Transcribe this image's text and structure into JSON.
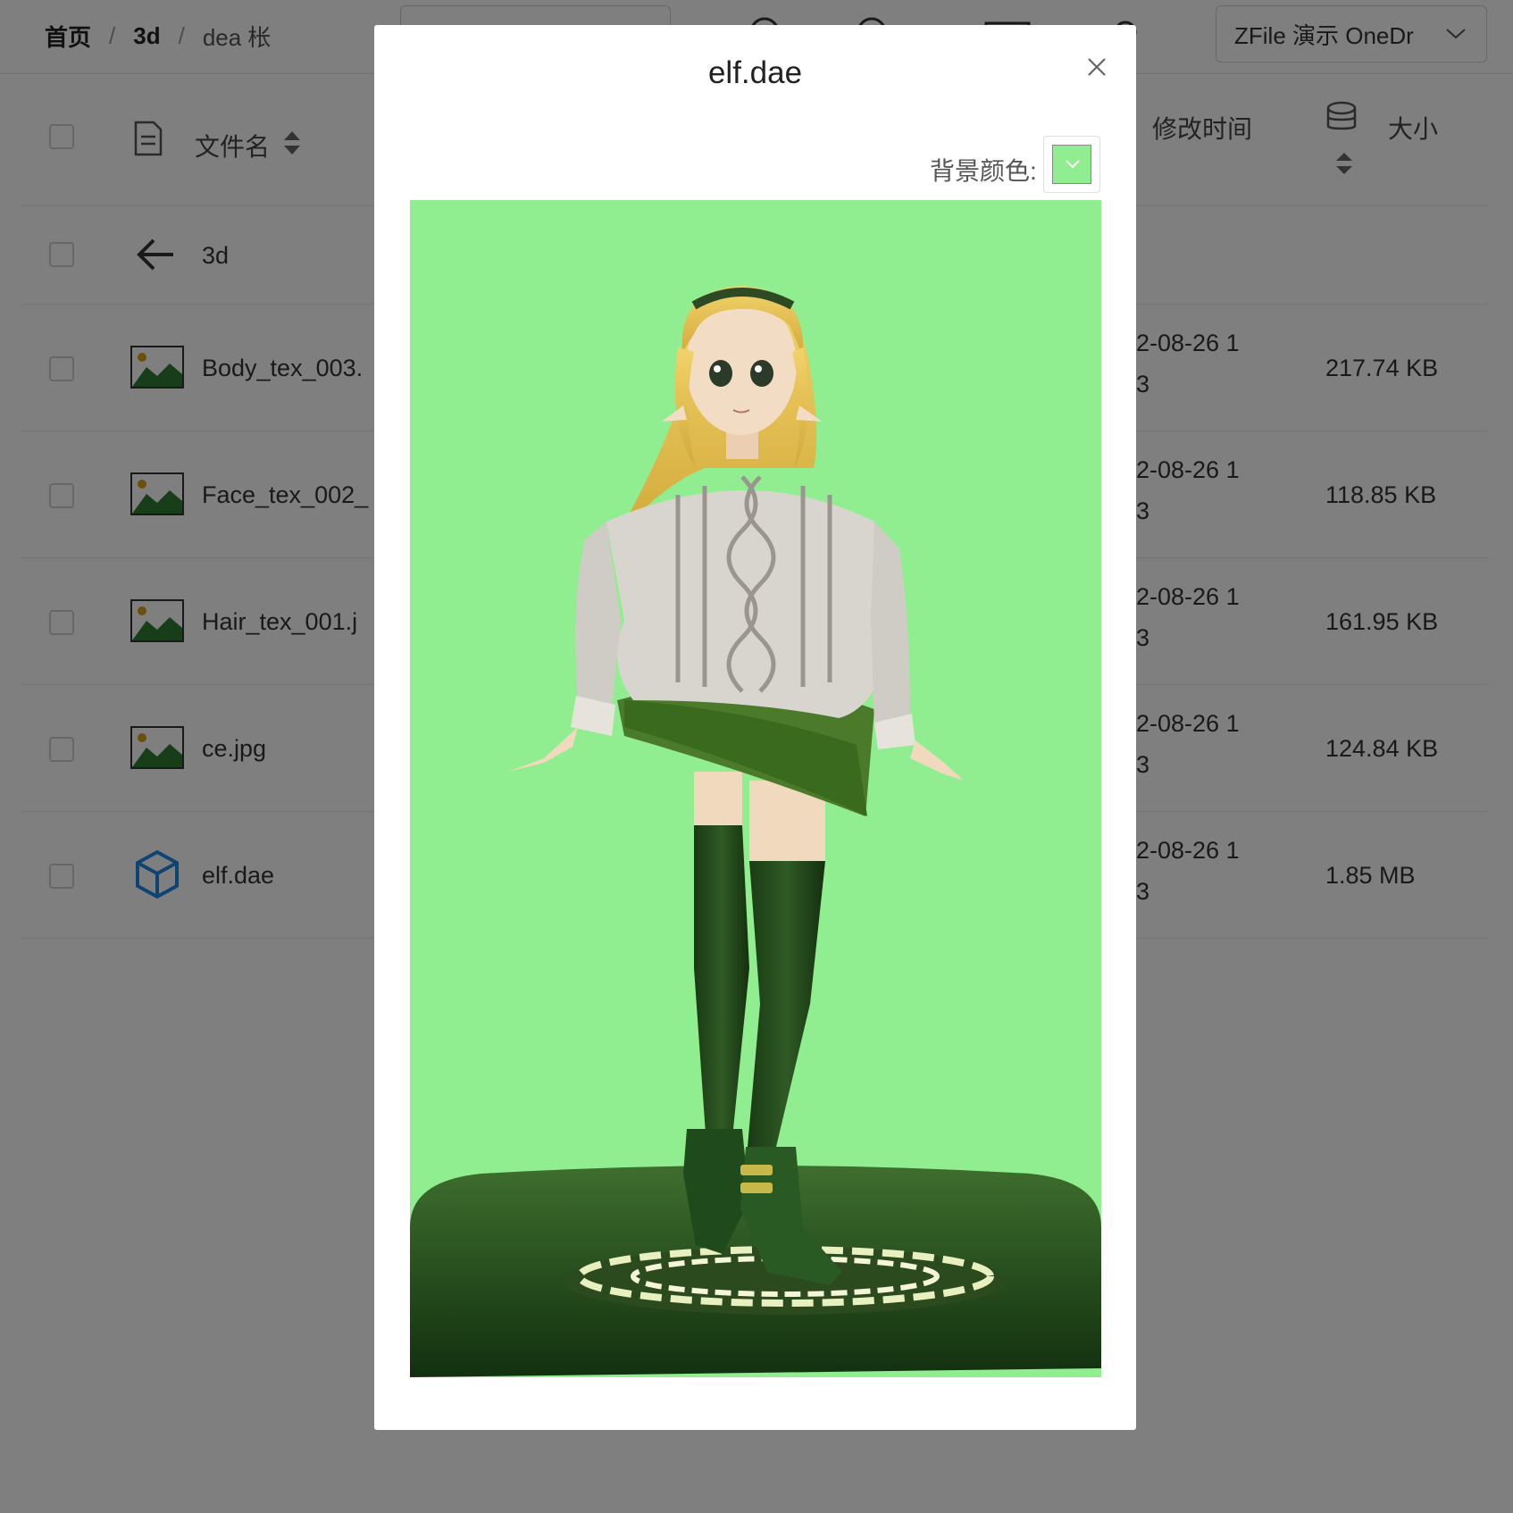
{
  "breadcrumb": {
    "home": "首页",
    "sep": "/",
    "folder": "3d",
    "current": "dea 枨"
  },
  "storage": {
    "selected": "ZFile 演示 OneDr"
  },
  "table": {
    "header": {
      "name": "文件名",
      "time": "修改时间",
      "size": "大小"
    },
    "back_label": "3d",
    "rows": [
      {
        "name": "Body_tex_003.",
        "time": "2-08-26 1",
        "time2": "3",
        "size": "217.74 KB",
        "icon": "image-file-icon"
      },
      {
        "name": "Face_tex_002_",
        "time": "2-08-26 1",
        "time2": "3",
        "size": "118.85 KB",
        "icon": "image-file-icon"
      },
      {
        "name": "Hair_tex_001.j",
        "time": "2-08-26 1",
        "time2": "3",
        "size": "161.95 KB",
        "icon": "image-file-icon"
      },
      {
        "name": "ce.jpg",
        "time": "2-08-26 1",
        "time2": "3",
        "size": "124.84 KB",
        "icon": "image-file-icon"
      },
      {
        "name": "elf.dae",
        "time": "2-08-26 1",
        "time2": "3",
        "size": "1.85 MB",
        "icon": "3d-model-cube-icon"
      }
    ]
  },
  "modal": {
    "title": "elf.dae",
    "bg_color_label": "背景颜色:",
    "bg_color": "#90ee90",
    "close_icon": "close-icon"
  },
  "colors": {
    "accent": "#1e88e5",
    "overlay": "rgba(0,0,0,0.5)",
    "viewer_bg": "#90ee90"
  }
}
